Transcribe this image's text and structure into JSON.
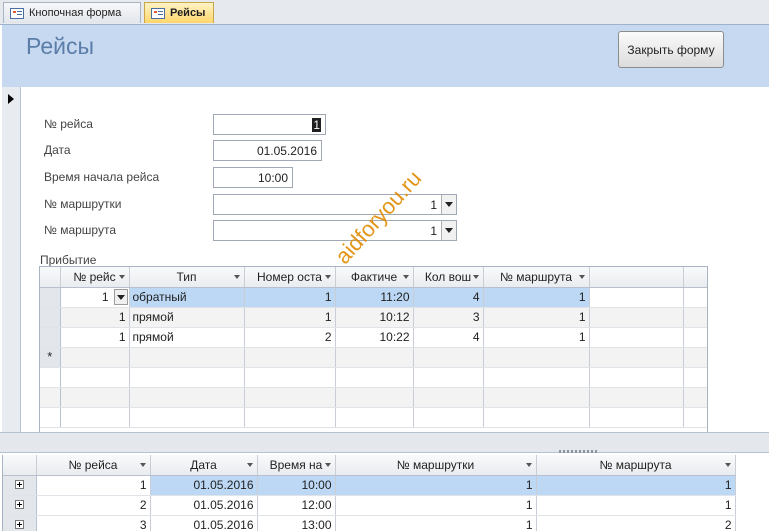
{
  "tabs": [
    {
      "label": "Кнопочная форма",
      "active": false
    },
    {
      "label": "Рейсы",
      "active": true
    }
  ],
  "form": {
    "title": "Рейсы",
    "close_button": "Закрыть форму",
    "fields": [
      {
        "label": "№ рейса",
        "value": "1"
      },
      {
        "label": "Дата",
        "value": "01.05.2016"
      },
      {
        "label": "Время начала рейса",
        "value": "10:00"
      },
      {
        "label": "№ маршрутки",
        "value": "1"
      },
      {
        "label": "№ маршрута",
        "value": "1"
      }
    ]
  },
  "arrivals": {
    "label": "Прибытие",
    "columns": [
      "№ рейс",
      "Тип",
      "Номер оста",
      "Фактиче",
      "Кол вош",
      "№ маршрута"
    ],
    "rows": [
      [
        "1",
        "обратный",
        "1",
        "11:20",
        "4",
        "1"
      ],
      [
        "1",
        "прямой",
        "1",
        "10:12",
        "3",
        "1"
      ],
      [
        "1",
        "прямой",
        "2",
        "10:22",
        "4",
        "1"
      ]
    ],
    "new_row_marker": "*"
  },
  "trips": {
    "columns": [
      "№ рейса",
      "Дата",
      "Время на",
      "№ маршрутки",
      "№ маршрута"
    ],
    "rows": [
      [
        "1",
        "01.05.2016",
        "10:00",
        "1",
        "1"
      ],
      [
        "2",
        "01.05.2016",
        "12:00",
        "1",
        "1"
      ],
      [
        "3",
        "01.05.2016",
        "13:00",
        "1",
        "2"
      ]
    ]
  },
  "watermark": "aidforyou.ru",
  "colors": {
    "header_bg": "#c6d9f1",
    "title": "#5b7da8",
    "active_tab": "#ffd66b",
    "selection": "#bcd8f4"
  }
}
